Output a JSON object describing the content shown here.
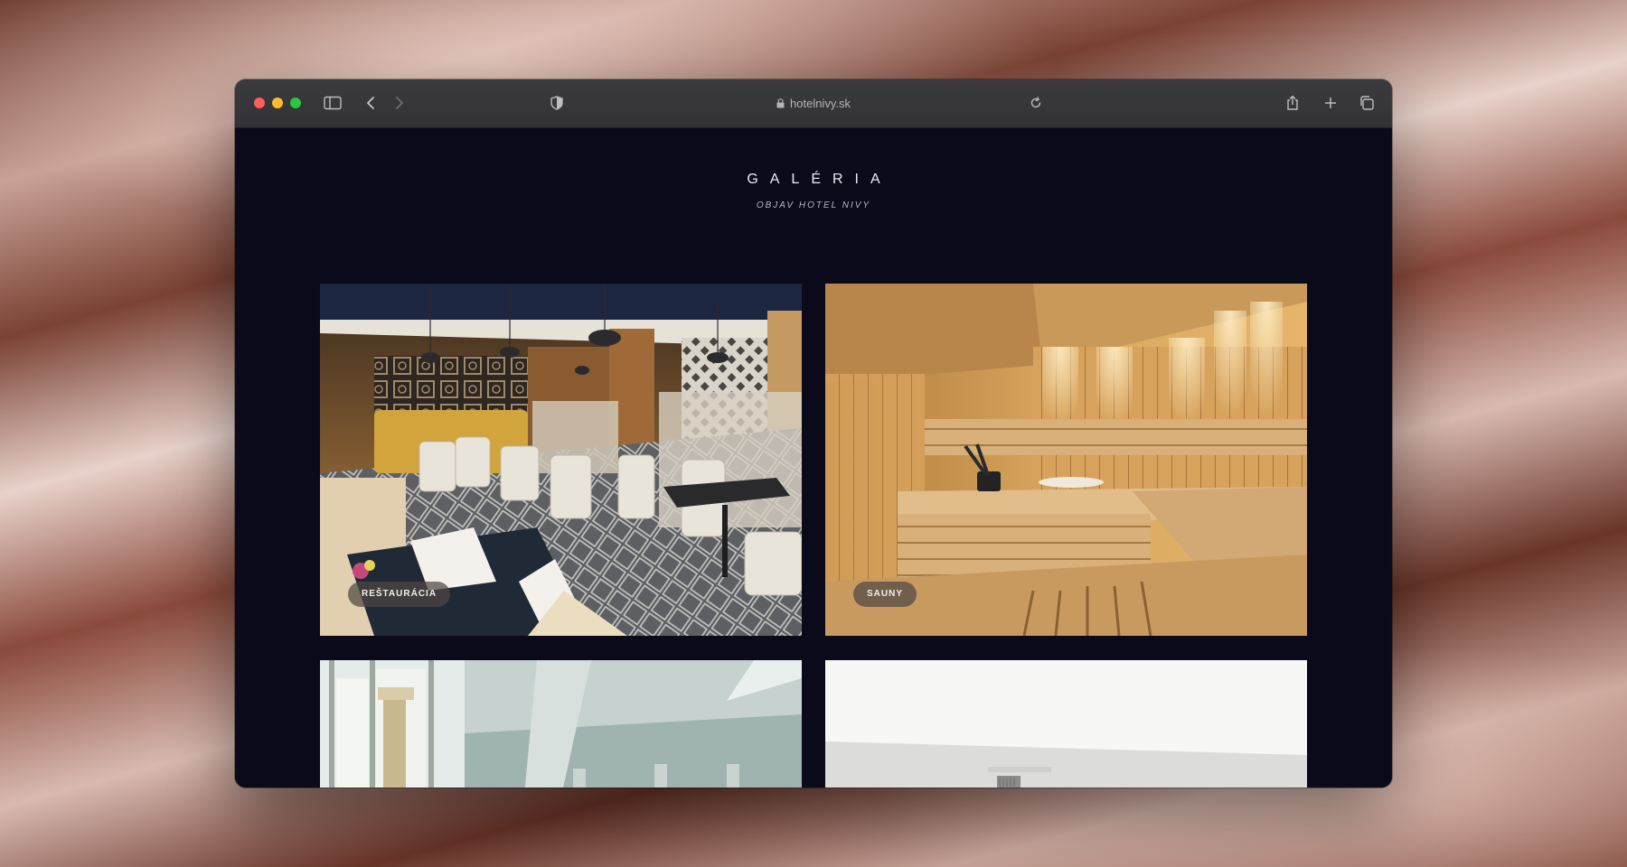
{
  "browser": {
    "url": "hotelnivy.sk"
  },
  "page": {
    "title": "GALÉRIA",
    "subtitle": "OBJAV HOTEL NIVY"
  },
  "gallery": [
    {
      "label": "REŠTAURÁCIA"
    },
    {
      "label": "SAUNY"
    },
    {
      "label": ""
    },
    {
      "label": ""
    }
  ]
}
